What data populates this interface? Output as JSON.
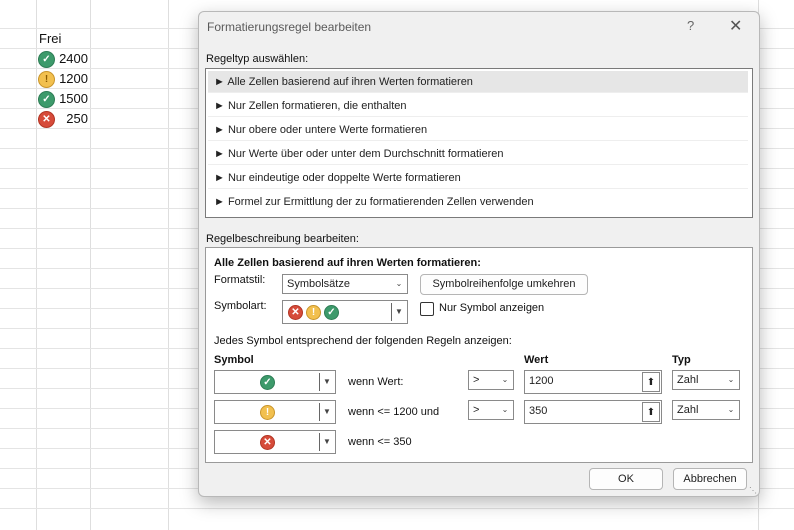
{
  "sheet": {
    "header": "Frei",
    "rows": [
      {
        "icon": "check-circle-icon",
        "value": "2400"
      },
      {
        "icon": "exclamation-circle-icon",
        "value": "1200"
      },
      {
        "icon": "check-circle-icon",
        "value": "1500"
      },
      {
        "icon": "x-circle-icon",
        "value": "250"
      }
    ]
  },
  "dialog": {
    "title": "Formatierungsregel bearbeiten",
    "help": "?",
    "close": "✕",
    "ruletype_label": "Regeltyp auswählen:",
    "rules": [
      "► Alle Zellen basierend auf ihren Werten formatieren",
      "► Nur Zellen formatieren, die enthalten",
      "► Nur obere oder untere Werte formatieren",
      "► Nur Werte über oder unter dem Durchschnitt formatieren",
      "► Nur eindeutige oder doppelte Werte formatieren",
      "► Formel zur Ermittlung der zu formatierenden Zellen verwenden"
    ],
    "desc_label": "Regelbeschreibung bearbeiten:",
    "desc_heading": "Alle Zellen basierend auf ihren Werten formatieren:",
    "formatstil_label": "Formatstil:",
    "formatstil_value": "Symbolsätze",
    "reverse_button": "Symbolreihenfolge umkehren",
    "symbolart_label": "Symbolart:",
    "only_symbol_label": "Nur Symbol anzeigen",
    "rules_caption": "Jedes Symbol entsprechend der folgenden Regeln anzeigen:",
    "col_symbol": "Symbol",
    "col_wert": "Wert",
    "col_typ": "Typ",
    "conditions": [
      {
        "icon": "check-circle-icon",
        "text": "wenn Wert:",
        "op": ">",
        "value": "1200",
        "type": "Zahl"
      },
      {
        "icon": "exclamation-circle-icon",
        "text": "wenn <= 1200 und",
        "op": ">",
        "value": "350",
        "type": "Zahl"
      },
      {
        "icon": "x-circle-icon",
        "text": "wenn <= 350"
      }
    ],
    "ok": "OK",
    "cancel": "Abbrechen"
  },
  "colors": {
    "green": "#3d9a6b",
    "yellow": "#f2c04f",
    "red": "#d64b3a"
  }
}
